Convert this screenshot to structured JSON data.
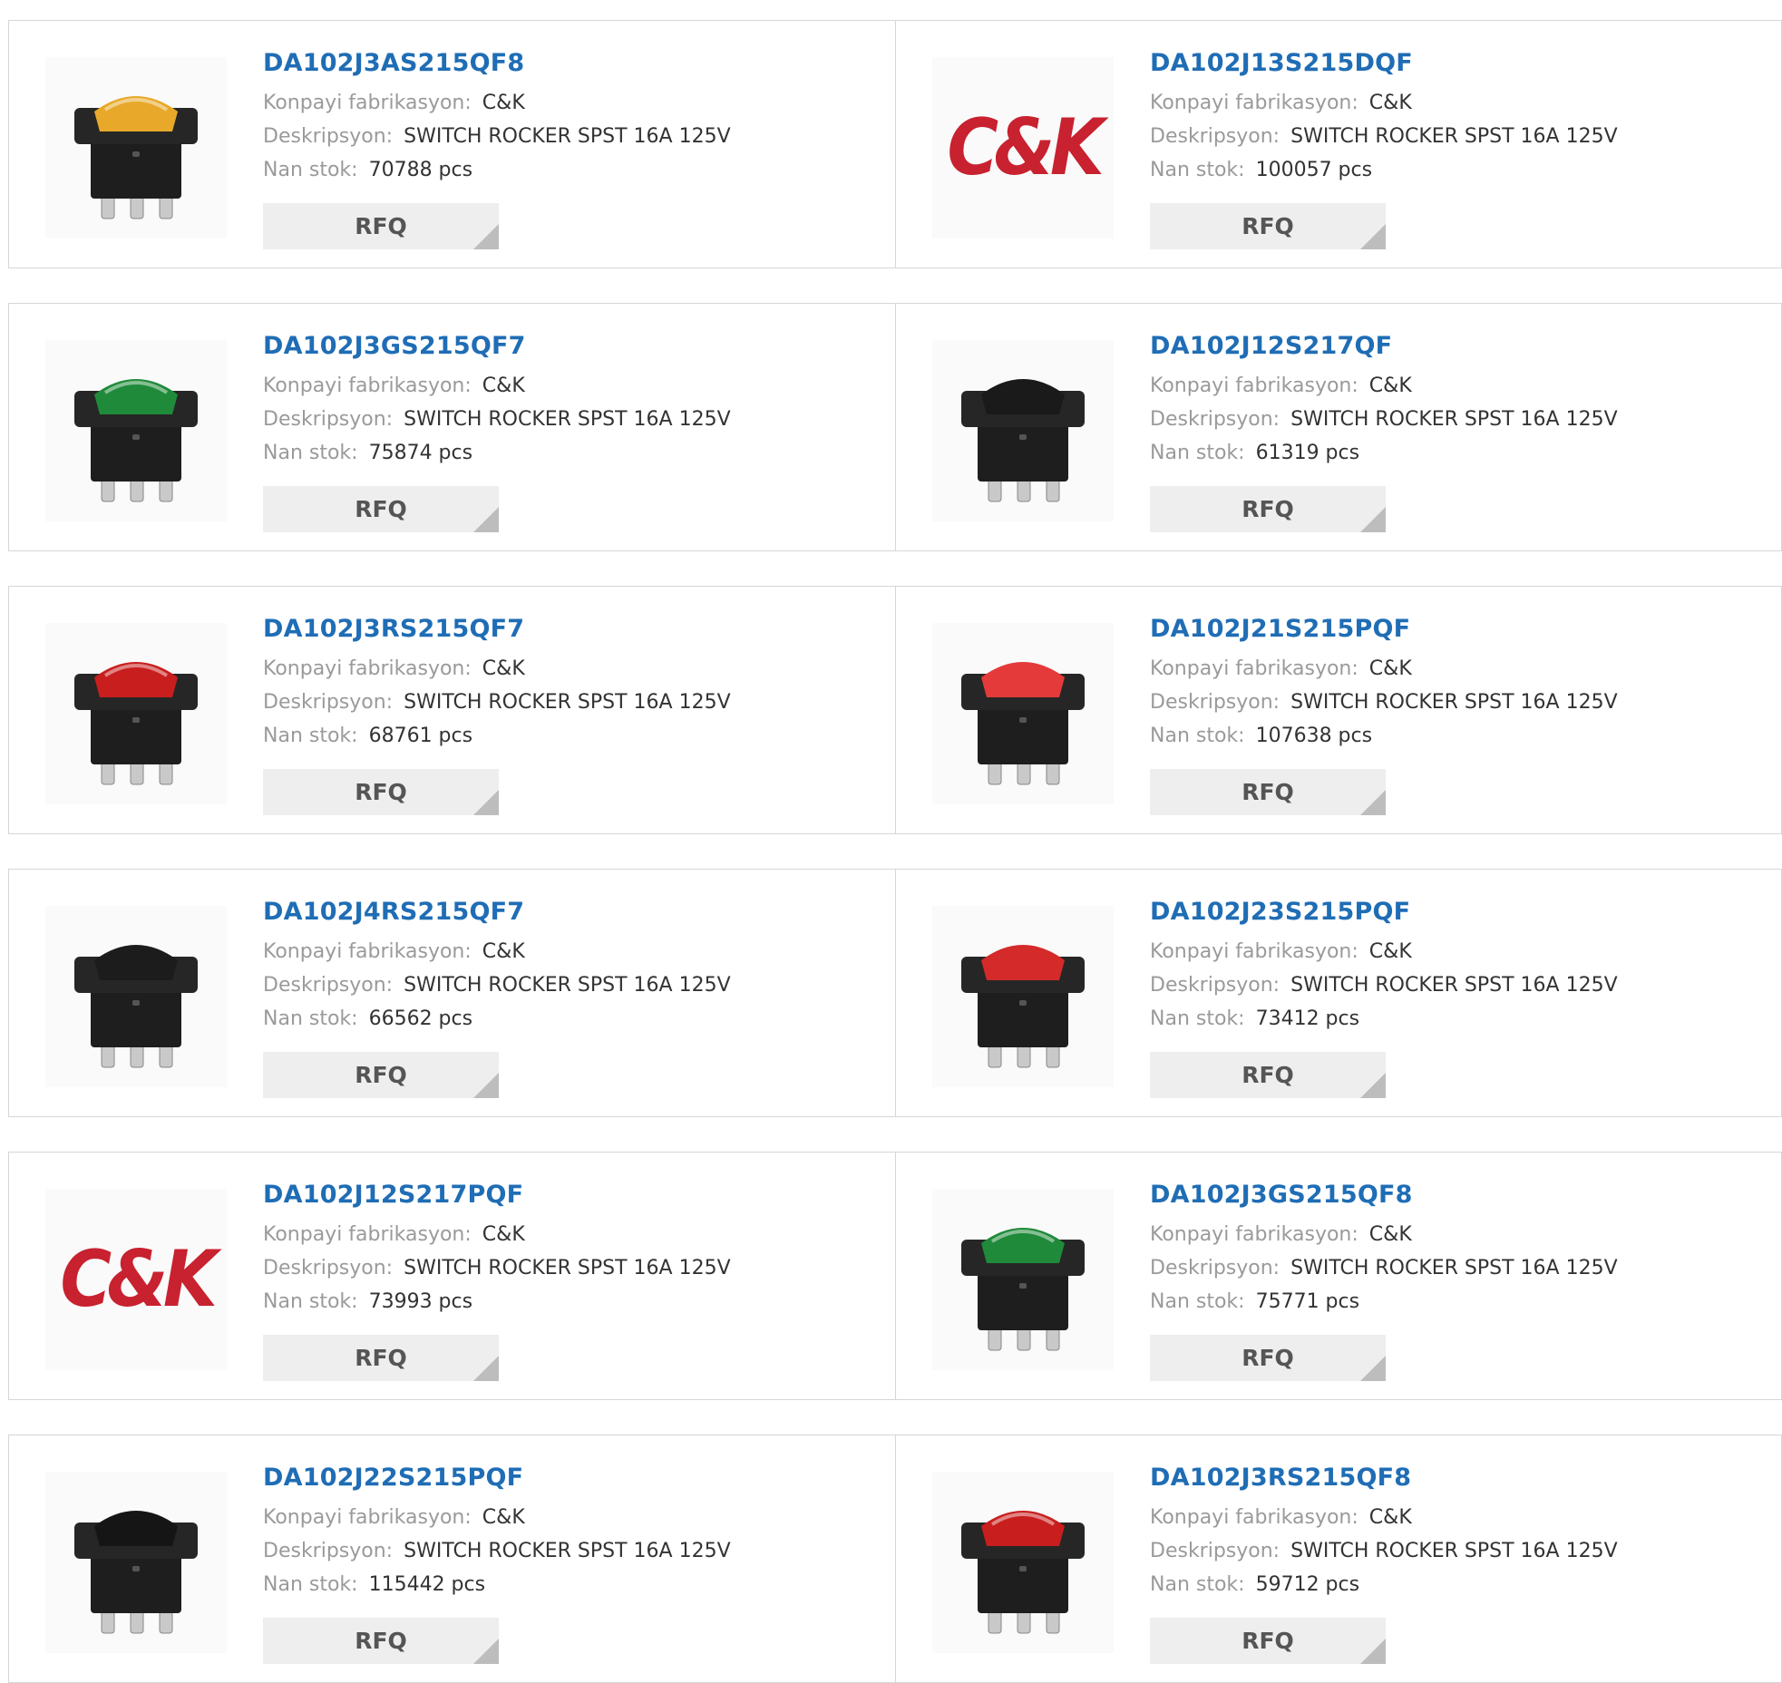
{
  "labels": {
    "manufacturer": "Konpayi fabrikasyon:",
    "description": "Deskripsyon:",
    "stock": "Nan stok:",
    "rfq": "RFQ"
  },
  "colors": {
    "part_link": "#1f6db5",
    "brand_red": "#c8212f",
    "rfq_bg": "#eeeeee"
  },
  "products": [
    {
      "part": "DA102J3AS215QF8",
      "manufacturer": "C&K",
      "description": "SWITCH ROCKER SPST 16A 125V",
      "stock": "70788 pcs",
      "image": "rocker-switch",
      "rocker_color": "#e8a92a",
      "lit": true
    },
    {
      "part": "DA102J13S215DQF",
      "manufacturer": "C&K",
      "description": "SWITCH ROCKER SPST 16A 125V",
      "stock": "100057 pcs",
      "image": "ck-logo",
      "logo_text": "C&K"
    },
    {
      "part": "DA102J3GS215QF7",
      "manufacturer": "C&K",
      "description": "SWITCH ROCKER SPST 16A 125V",
      "stock": "75874 pcs",
      "image": "rocker-switch",
      "rocker_color": "#1f8a3a",
      "lit": true
    },
    {
      "part": "DA102J12S217QF",
      "manufacturer": "C&K",
      "description": "SWITCH ROCKER SPST 16A 125V",
      "stock": "61319 pcs",
      "image": "rocker-switch",
      "rocker_color": "#1a1a1a",
      "lit": false
    },
    {
      "part": "DA102J3RS215QF7",
      "manufacturer": "C&K",
      "description": "SWITCH ROCKER SPST 16A 125V",
      "stock": "68761 pcs",
      "image": "rocker-switch",
      "rocker_color": "#c81e1e",
      "lit": true
    },
    {
      "part": "DA102J21S215PQF",
      "manufacturer": "C&K",
      "description": "SWITCH ROCKER SPST 16A 125V",
      "stock": "107638 pcs",
      "image": "rocker-switch",
      "rocker_color": "#e43a3a",
      "lit": false
    },
    {
      "part": "DA102J4RS215QF7",
      "manufacturer": "C&K",
      "description": "SWITCH ROCKER SPST 16A 125V",
      "stock": "66562 pcs",
      "image": "rocker-switch",
      "rocker_color": "#1c1c1c",
      "lit": false
    },
    {
      "part": "DA102J23S215PQF",
      "manufacturer": "C&K",
      "description": "SWITCH ROCKER SPST 16A 125V",
      "stock": "73412 pcs",
      "image": "rocker-switch",
      "rocker_color": "#d42a2a",
      "lit": false
    },
    {
      "part": "DA102J12S217PQF",
      "manufacturer": "C&K",
      "description": "SWITCH ROCKER SPST 16A 125V",
      "stock": "73993 pcs",
      "image": "ck-logo",
      "logo_text": "C&K"
    },
    {
      "part": "DA102J3GS215QF8",
      "manufacturer": "C&K",
      "description": "SWITCH ROCKER SPST 16A 125V",
      "stock": "75771 pcs",
      "image": "rocker-switch",
      "rocker_color": "#1f8a3a",
      "lit": true
    },
    {
      "part": "DA102J22S215PQF",
      "manufacturer": "C&K",
      "description": "SWITCH ROCKER SPST 16A 125V",
      "stock": "115442 pcs",
      "image": "rocker-switch",
      "rocker_color": "#151515",
      "lit": false
    },
    {
      "part": "DA102J3RS215QF8",
      "manufacturer": "C&K",
      "description": "SWITCH ROCKER SPST 16A 125V",
      "stock": "59712 pcs",
      "image": "rocker-switch",
      "rocker_color": "#c81e1e",
      "lit": true
    }
  ]
}
